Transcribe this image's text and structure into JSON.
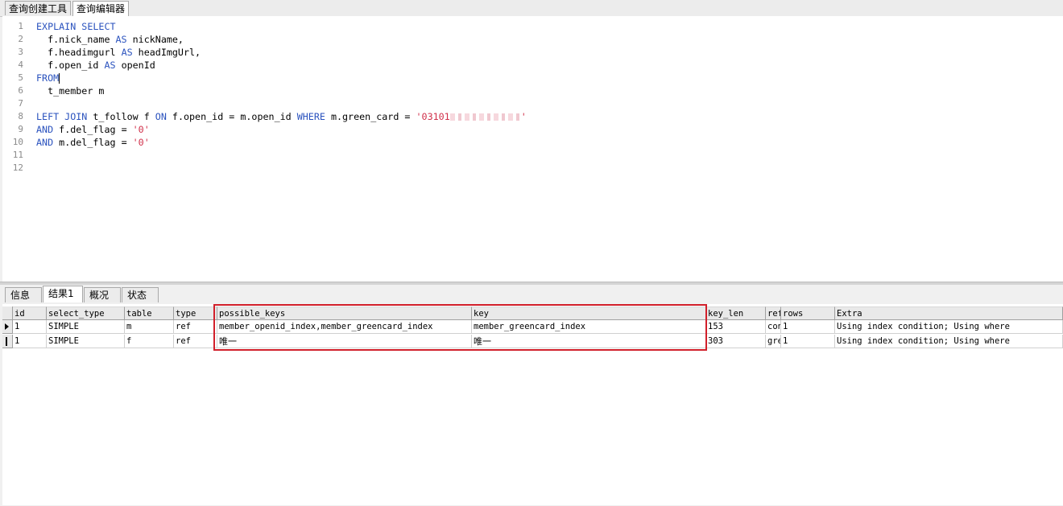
{
  "top_tabs": [
    "查询创建工具",
    "查询编辑器"
  ],
  "editor": {
    "line_numbers": [
      "1",
      "2",
      "3",
      "4",
      "5",
      "6",
      "7",
      "8",
      "9",
      "10",
      "11",
      "12"
    ],
    "lines": [
      [
        {
          "t": "EXPLAIN SELECT",
          "k": "kw"
        }
      ],
      [
        {
          "t": "  f.nick_name ",
          "k": ""
        },
        {
          "t": "AS",
          "k": "kw"
        },
        {
          "t": " nickName,",
          "k": ""
        }
      ],
      [
        {
          "t": "  f.headimgurl ",
          "k": ""
        },
        {
          "t": "AS",
          "k": "kw"
        },
        {
          "t": " headImgUrl,",
          "k": ""
        }
      ],
      [
        {
          "t": "  f.open_id ",
          "k": ""
        },
        {
          "t": "AS",
          "k": "kw"
        },
        {
          "t": " openId",
          "k": ""
        }
      ],
      [
        {
          "t": "FROM",
          "k": "kw"
        },
        {
          "t": "",
          "k": "caret"
        }
      ],
      [
        {
          "t": "  t_member m",
          "k": ""
        }
      ],
      [],
      [
        {
          "t": "LEFT JOIN",
          "k": "kw"
        },
        {
          "t": " t_follow f ",
          "k": ""
        },
        {
          "t": "ON",
          "k": "kw"
        },
        {
          "t": " f.open_id = m.open_id ",
          "k": ""
        },
        {
          "t": "WHERE",
          "k": "kw"
        },
        {
          "t": " m.green_card = ",
          "k": ""
        },
        {
          "t": "'03101",
          "k": "str"
        },
        {
          "t": "",
          "k": "blur"
        },
        {
          "t": "'",
          "k": "str"
        }
      ],
      [
        {
          "t": "AND",
          "k": "kw"
        },
        {
          "t": " f.del_flag = ",
          "k": ""
        },
        {
          "t": "'0'",
          "k": "str"
        }
      ],
      [
        {
          "t": "AND",
          "k": "kw"
        },
        {
          "t": " m.del_flag = ",
          "k": ""
        },
        {
          "t": "'0'",
          "k": "str"
        }
      ],
      [],
      []
    ]
  },
  "result_tabs": [
    "信息",
    "结果1",
    "概况",
    "状态"
  ],
  "result_table": {
    "columns": [
      "id",
      "select_type",
      "table",
      "type",
      "possible_keys",
      "key",
      "key_len",
      "ref",
      "rows",
      "Extra"
    ],
    "rows": [
      [
        "1",
        "SIMPLE",
        "m",
        "ref",
        "member_openid_index,member_greencard_index",
        "member_greencard_index",
        "153",
        "con",
        "1",
        "Using index condition; Using where"
      ],
      [
        "1",
        "SIMPLE",
        "f",
        "ref",
        "唯一",
        "唯一",
        "303",
        "gre",
        "1",
        "Using index condition; Using where"
      ]
    ]
  },
  "colors": {
    "keyword": "#2a52be",
    "string": "#d0304a",
    "highlight": "#d11f2a"
  }
}
